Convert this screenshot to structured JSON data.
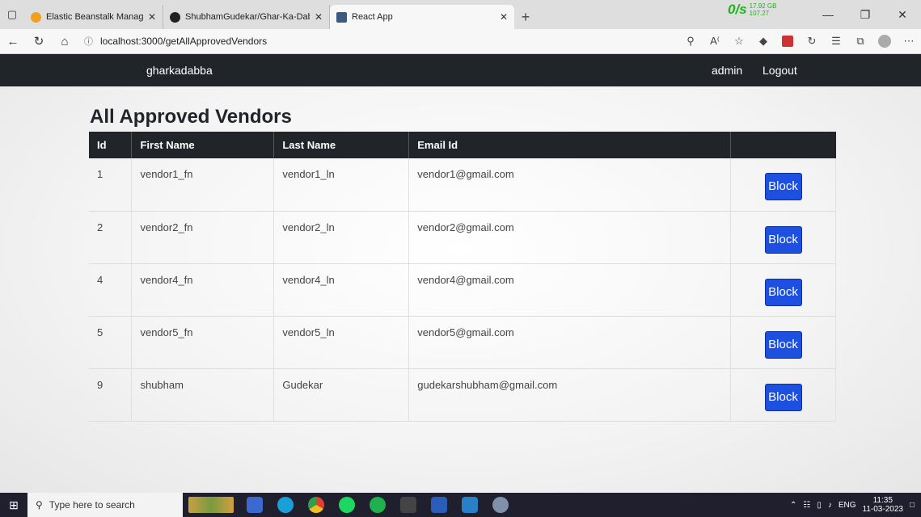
{
  "browser": {
    "tabs": [
      {
        "title": "Elastic Beanstalk Management C",
        "favicon_color": "#f0a020"
      },
      {
        "title": "ShubhamGudekar/Ghar-Ka-Dab",
        "favicon_color": "#222222"
      },
      {
        "title": "React App",
        "favicon_color": "#3a5a80"
      }
    ],
    "new_tab": "+",
    "network_rate": "0/s",
    "network_total": "17.92 GB",
    "network_sub": "107.27",
    "url": "localhost:3000/getAllApprovedVendors"
  },
  "navbar": {
    "brand": "gharkadabba",
    "admin": "admin",
    "logout": "Logout"
  },
  "page": {
    "title": "All Approved Vendors"
  },
  "table": {
    "headers": [
      "Id",
      "First Name",
      "Last Name",
      "Email Id",
      ""
    ],
    "rows": [
      {
        "id": "1",
        "first": "vendor1_fn",
        "last": "vendor1_ln",
        "email": "vendor1@gmail.com",
        "action": "Block"
      },
      {
        "id": "2",
        "first": "vendor2_fn",
        "last": "vendor2_ln",
        "email": "vendor2@gmail.com",
        "action": "Block"
      },
      {
        "id": "4",
        "first": "vendor4_fn",
        "last": "vendor4_ln",
        "email": "vendor4@gmail.com",
        "action": "Block"
      },
      {
        "id": "5",
        "first": "vendor5_fn",
        "last": "vendor5_ln",
        "email": "vendor5@gmail.com",
        "action": "Block"
      },
      {
        "id": "9",
        "first": "shubham",
        "last": "Gudekar",
        "email": "gudekarshubham@gmail.com",
        "action": "Block"
      }
    ]
  },
  "colors": {
    "navbar_bg": "#212529",
    "block_button": "#1d4fe0"
  },
  "taskbar": {
    "search_placeholder": "Type here to search",
    "apps": [
      "file-explorer",
      "edge",
      "chrome",
      "spotify",
      "mongodb-compass",
      "terminal",
      "word",
      "vscode",
      "paint"
    ],
    "lang": "ENG",
    "time": "11:35",
    "date": "11-03-2023"
  }
}
